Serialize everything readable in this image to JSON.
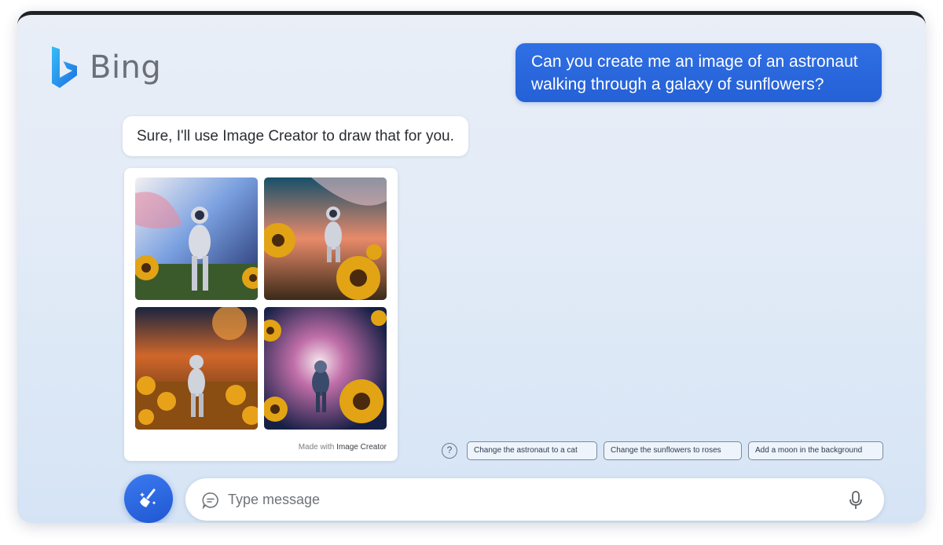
{
  "app": {
    "logo_text": "Bing",
    "accent_color": "#2563d9"
  },
  "conversation": {
    "user_message": "Can you create me an image of an astronaut walking through a galaxy of sunflowers?",
    "bot_message": "Sure, I'll use Image Creator to draw that for you."
  },
  "image_result": {
    "footer_prefix": "Made with",
    "footer_brand": "Image Creator",
    "images": [
      {
        "icon": "astronaut-sunflowers-image"
      },
      {
        "icon": "astronaut-sunflowers-image"
      },
      {
        "icon": "astronaut-sunflowers-image"
      },
      {
        "icon": "astronaut-sunflowers-image"
      }
    ]
  },
  "suggestions": {
    "help_icon": "?",
    "chips": [
      "Change the astronaut to a cat",
      "Change the sunflowers to roses",
      "Add a moon in the background"
    ]
  },
  "composer": {
    "placeholder": "Type message",
    "left_button_icon": "broom-icon",
    "mic_icon": "microphone-icon"
  }
}
